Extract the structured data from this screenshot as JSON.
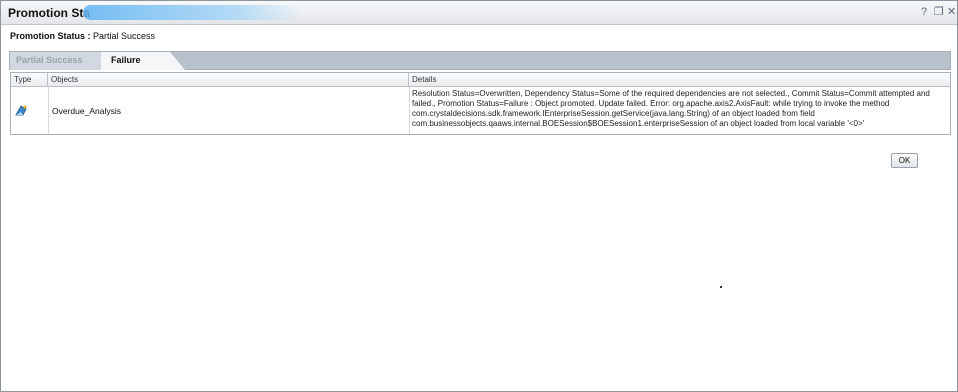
{
  "window": {
    "title": "Promotion Sta",
    "help_label": "?",
    "maximize_label": "❐",
    "close_label": "✕"
  },
  "status": {
    "label": "Promotion Status :",
    "value": "Partial Success"
  },
  "tabs": [
    {
      "label": "Partial Success",
      "active": false
    },
    {
      "label": "Failure",
      "active": true
    }
  ],
  "table": {
    "columns": [
      "Type",
      "Objects",
      "Details"
    ],
    "rows": [
      {
        "type_icon": "report-icon",
        "object": "Overdue_Analysis",
        "details": "Resolution Status=Overwritten, Dependency Status=Some of the required dependencies are not selected., Commit Status=Commit attempted and failed., Promotion Status=Failure : Object promoted. Update failed. Error: org.apache.axis2.AxisFault: while trying to invoke the method com.crystaldecisions.sdk.framework.IEnterpriseSession.getService(java.lang.String) of an object loaded from field com.businessobjects.qaaws.internal.BOESession$BOESession1.enterpriseSession of an object loaded from local variable '<0>'"
      }
    ]
  },
  "buttons": {
    "ok_label": "OK"
  },
  "colors": {
    "accent": "#5fb4f2",
    "tab_strip": "#b9c2cc"
  }
}
